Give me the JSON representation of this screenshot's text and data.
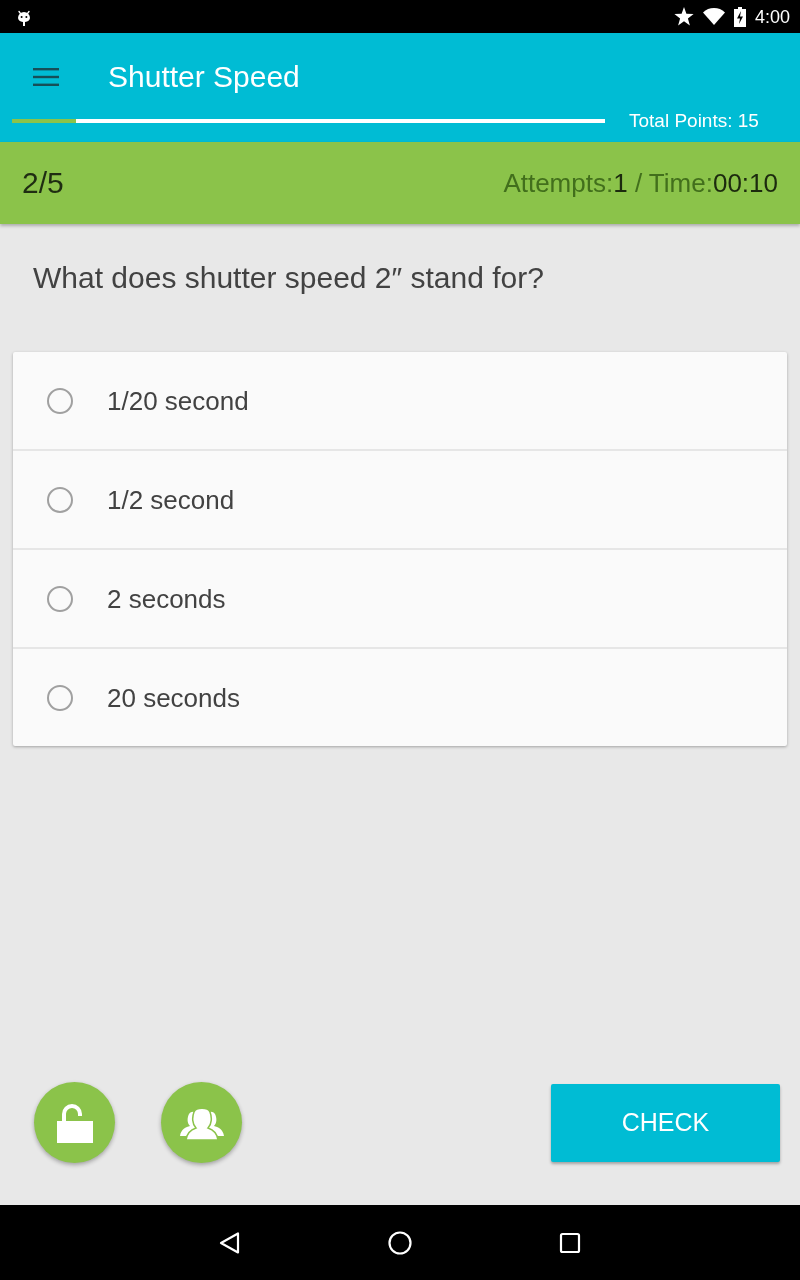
{
  "status_bar": {
    "time": "4:00"
  },
  "app_bar": {
    "title": "Shutter Speed",
    "progress": {
      "level": 0.108
    },
    "total_points": "Total Points: 15"
  },
  "quiz_header": {
    "counter": "2/5",
    "attempts_label": "Attempts:",
    "attempts": "1",
    "time_label": " / Time:",
    "time": "00:10"
  },
  "question": "What does shutter speed 2″ stand for?",
  "options": [
    {
      "label": "1/20 second",
      "selected": false
    },
    {
      "label": "1/2 second",
      "selected": false
    },
    {
      "label": "2 seconds",
      "selected": false
    },
    {
      "label": "20 seconds",
      "selected": false
    }
  ],
  "actions": {
    "check_button": "CHECK"
  }
}
